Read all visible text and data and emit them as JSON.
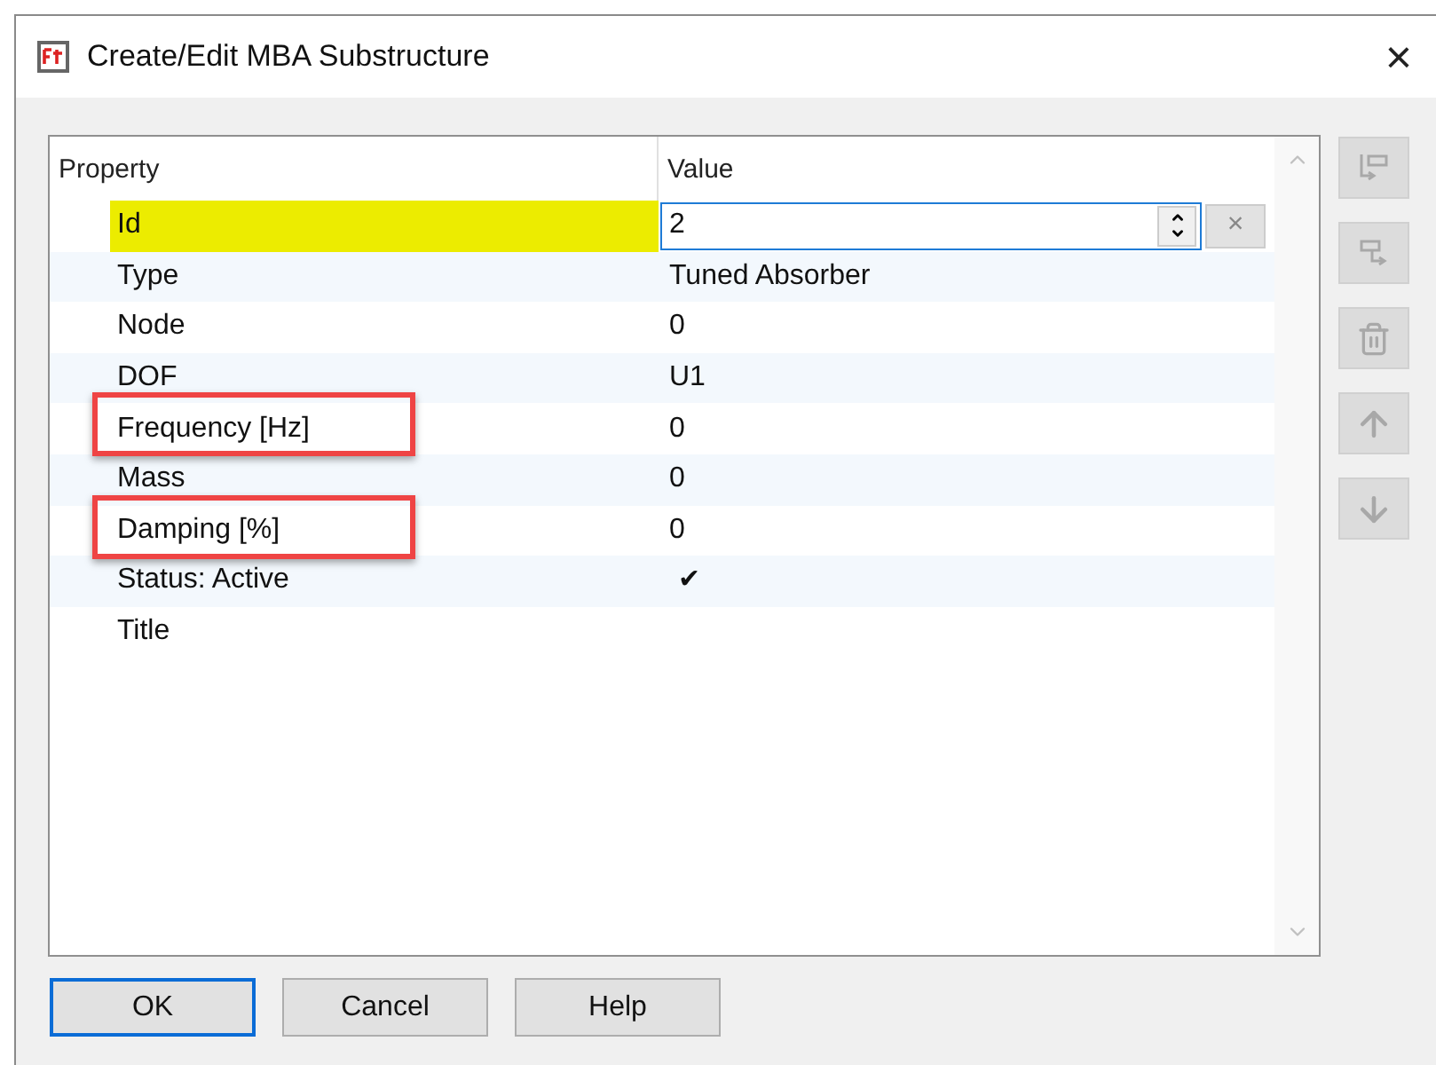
{
  "window": {
    "title": "Create/Edit MBA Substructure",
    "close": "×"
  },
  "grid": {
    "columns": [
      "Property",
      "Value"
    ],
    "rows": [
      {
        "kind": "edit",
        "label": "Id",
        "value": "2",
        "selected": true,
        "highlighted": false,
        "clear": "×"
      },
      {
        "kind": "text",
        "label": "Type",
        "value": "Tuned Absorber",
        "selected": false,
        "highlighted": false
      },
      {
        "kind": "text",
        "label": "Node",
        "value": "0",
        "selected": false,
        "highlighted": false
      },
      {
        "kind": "text",
        "label": "DOF",
        "value": "U1",
        "selected": false,
        "highlighted": false
      },
      {
        "kind": "text",
        "label": "Frequency [Hz]",
        "value": "0",
        "selected": false,
        "highlighted": true
      },
      {
        "kind": "text",
        "label": "Mass",
        "value": "0",
        "selected": false,
        "highlighted": false
      },
      {
        "kind": "text",
        "label": "Damping [%]",
        "value": "0",
        "selected": false,
        "highlighted": true
      },
      {
        "kind": "check",
        "label": "Status: Active",
        "value": "✔",
        "checked": true,
        "selected": false,
        "highlighted": false
      },
      {
        "kind": "text",
        "label": "Title",
        "selected": false,
        "highlighted": false
      }
    ]
  },
  "toolbar": [
    {
      "kind": "add-child",
      "disabled": true
    },
    {
      "kind": "add-sibling",
      "disabled": true
    },
    {
      "kind": "delete",
      "disabled": true
    },
    {
      "kind": "up",
      "disabled": true
    },
    {
      "kind": "down",
      "disabled": true
    }
  ],
  "buttons": [
    {
      "label": "OK",
      "default": true
    },
    {
      "label": "Cancel",
      "default": false
    },
    {
      "label": "Help",
      "default": false
    }
  ]
}
